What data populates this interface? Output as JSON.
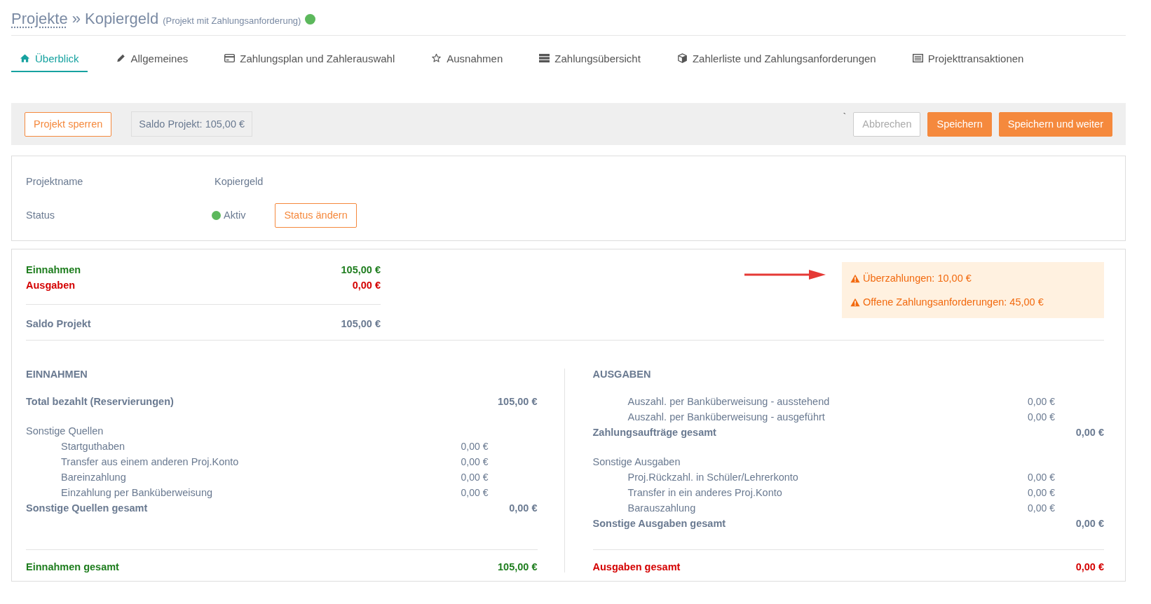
{
  "breadcrumb": {
    "parent": "Projekte",
    "separator": "»",
    "current": "Kopiergeld",
    "note": "(Projekt mit Zahlungsanforderung)"
  },
  "tabs": [
    {
      "label": "Überblick",
      "selected": true
    },
    {
      "label": "Allgemeines",
      "selected": false
    },
    {
      "label": "Zahlungsplan und Zahlerauswahl",
      "selected": false
    },
    {
      "label": "Ausnahmen",
      "selected": false
    },
    {
      "label": "Zahlungsübersicht",
      "selected": false
    },
    {
      "label": "Zahlerliste und Zahlungsanforderungen",
      "selected": false
    },
    {
      "label": "Projekttransaktionen",
      "selected": false
    }
  ],
  "toolbar": {
    "lock_button": "Projekt sperren",
    "balance": "Saldo Projekt: 105,00 €",
    "stray_mark": "`",
    "cancel_button": "Abbrechen",
    "save_button": "Speichern",
    "save_next_button": "Speichern und weiter"
  },
  "info": {
    "fields": [
      {
        "label": "Projektname",
        "value": "Kopiergeld"
      },
      {
        "label": "Status",
        "value": "Aktiv",
        "action": "Status ändern"
      }
    ]
  },
  "summary": {
    "lines": [
      {
        "label": "Einnahmen",
        "value": "105,00 €",
        "color": "#1e7d1e"
      },
      {
        "label": "Ausgaben",
        "value": "0,00 €",
        "color": "#d40000"
      }
    ],
    "balance": {
      "label": "Saldo Projekt",
      "value": "105,00 €"
    },
    "warnings": [
      "Überzahlungen: 10,00 €",
      "Offene Zahlungsanforderungen: 45,00 €"
    ]
  },
  "columns": [
    {
      "heading": "EINNAHMEN",
      "rows": [
        {
          "kind": "total",
          "label": "Total bezahlt (Reservierungen)",
          "value": "105,00 €"
        },
        {
          "kind": "group",
          "label": "Sonstige Quellen"
        },
        {
          "kind": "item",
          "label": "Startguthaben",
          "value": "0,00 €"
        },
        {
          "kind": "item",
          "label": "Transfer aus einem anderen Proj.Konto",
          "value": "0,00 €"
        },
        {
          "kind": "item",
          "label": "Bareinzahlung",
          "value": "0,00 €"
        },
        {
          "kind": "item",
          "label": "Einzahlung per Banküberweisung",
          "value": "0,00 €"
        },
        {
          "kind": "subtotal",
          "label": "Sonstige Quellen gesamt",
          "value": "0,00 €"
        }
      ],
      "footer": {
        "label": "Einnahmen gesamt",
        "value": "105,00 €",
        "color": "#1e7d1e"
      }
    },
    {
      "heading": "AUSGABEN",
      "rows": [
        {
          "kind": "item",
          "label": "Auszahl. per Banküberweisung - ausstehend",
          "value": "0,00 €"
        },
        {
          "kind": "item",
          "label": "Auszahl. per Banküberweisung - ausgeführt",
          "value": "0,00 €"
        },
        {
          "kind": "subtotal",
          "label": "Zahlungsaufträge gesamt",
          "value": "0,00 €"
        },
        {
          "kind": "group",
          "label": "Sonstige Ausgaben"
        },
        {
          "kind": "item",
          "label": "Proj.Rückzahl. in Schüler/Lehrerkonto",
          "value": "0,00 €"
        },
        {
          "kind": "item",
          "label": "Transfer in ein anderes Proj.Konto",
          "value": "0,00 €"
        },
        {
          "kind": "item",
          "label": "Barauszahlung",
          "value": "0,00 €"
        },
        {
          "kind": "subtotal",
          "label": "Sonstige Ausgaben gesamt",
          "value": "0,00 €"
        }
      ],
      "footer": {
        "label": "Ausgaben gesamt",
        "value": "0,00 €",
        "color": "#d40000"
      }
    }
  ]
}
